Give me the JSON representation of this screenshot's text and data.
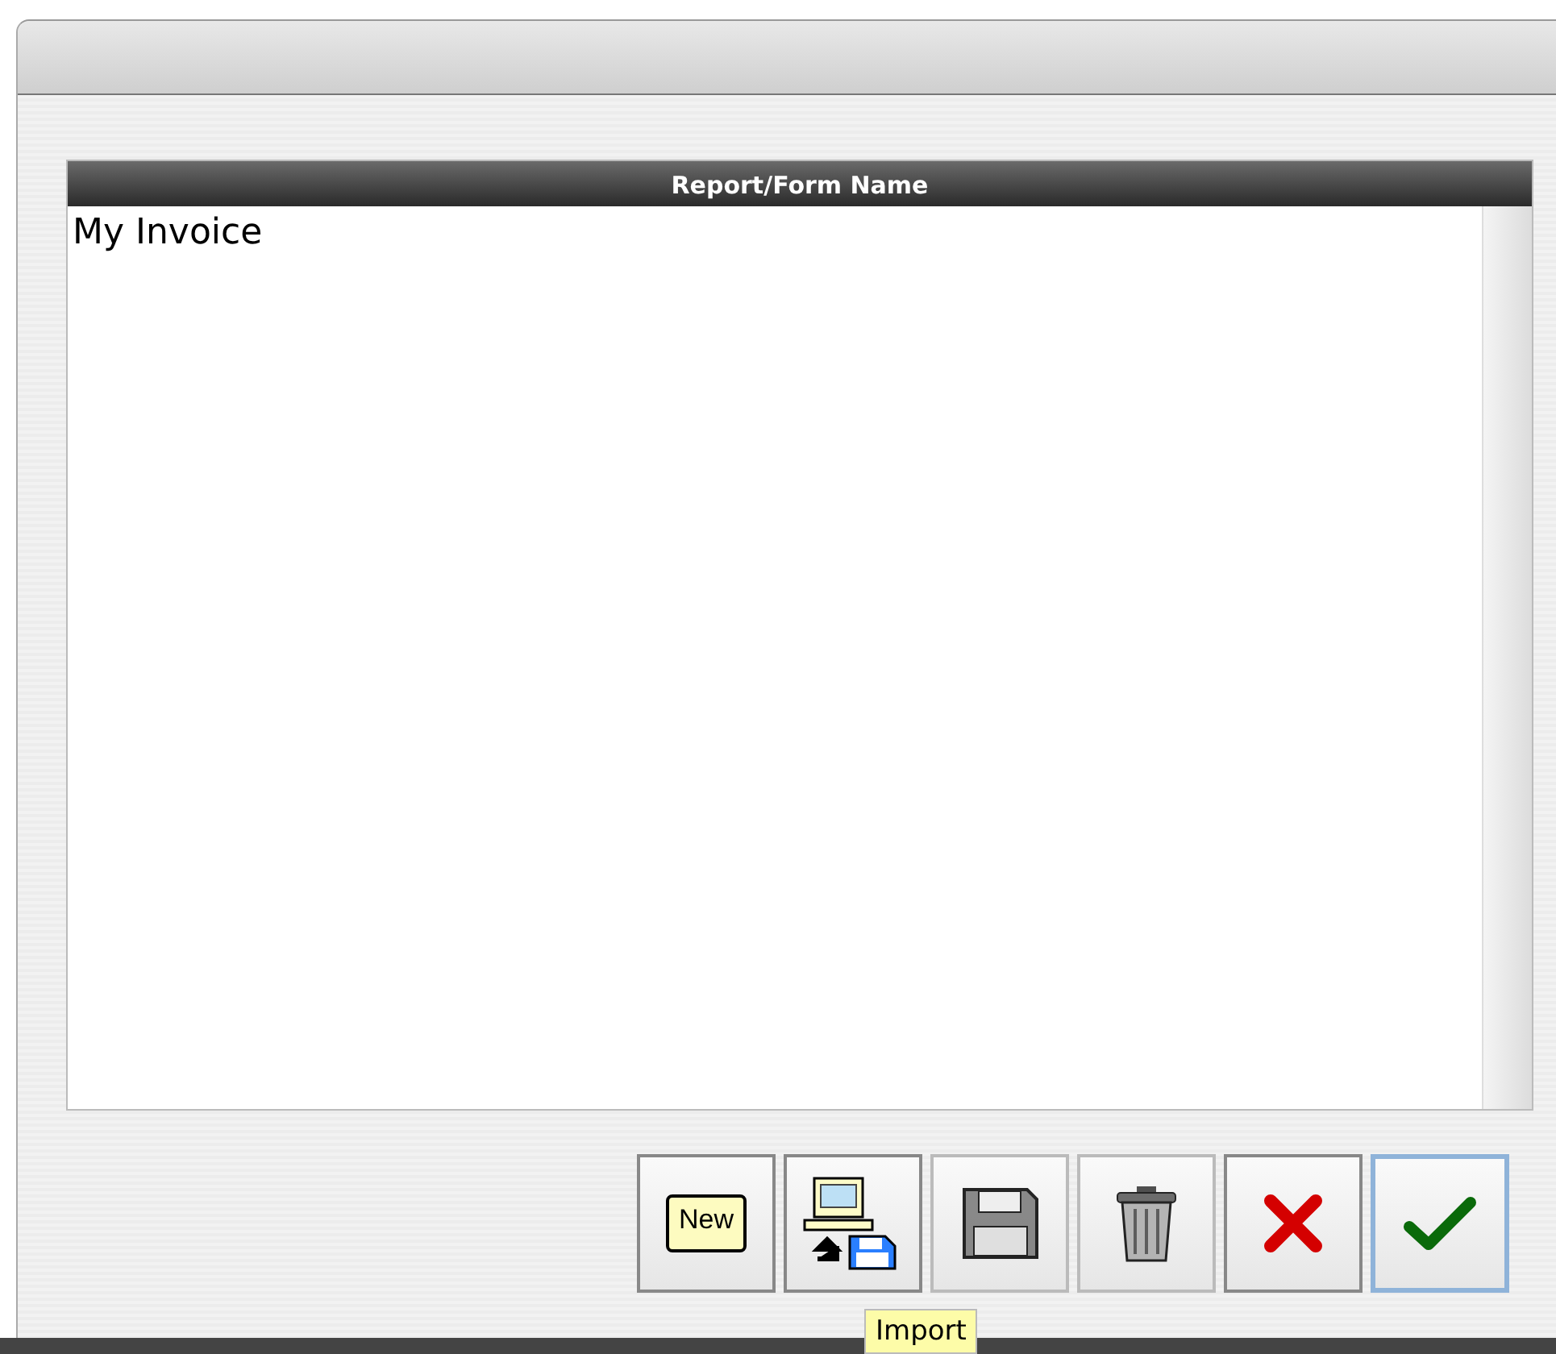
{
  "list": {
    "column_header": "Report/Form Name",
    "rows": [
      {
        "name": "My Invoice",
        "selected": false
      }
    ]
  },
  "buttons": [
    {
      "kind": "new",
      "label": "New",
      "disabled": false,
      "default": false
    },
    {
      "kind": "import",
      "disabled": false,
      "default": false
    },
    {
      "kind": "save",
      "disabled": true,
      "default": false
    },
    {
      "kind": "delete",
      "disabled": true,
      "default": false
    },
    {
      "kind": "cancel",
      "disabled": false,
      "default": false
    },
    {
      "kind": "ok",
      "disabled": false,
      "default": true
    }
  ],
  "tooltip": "Import"
}
